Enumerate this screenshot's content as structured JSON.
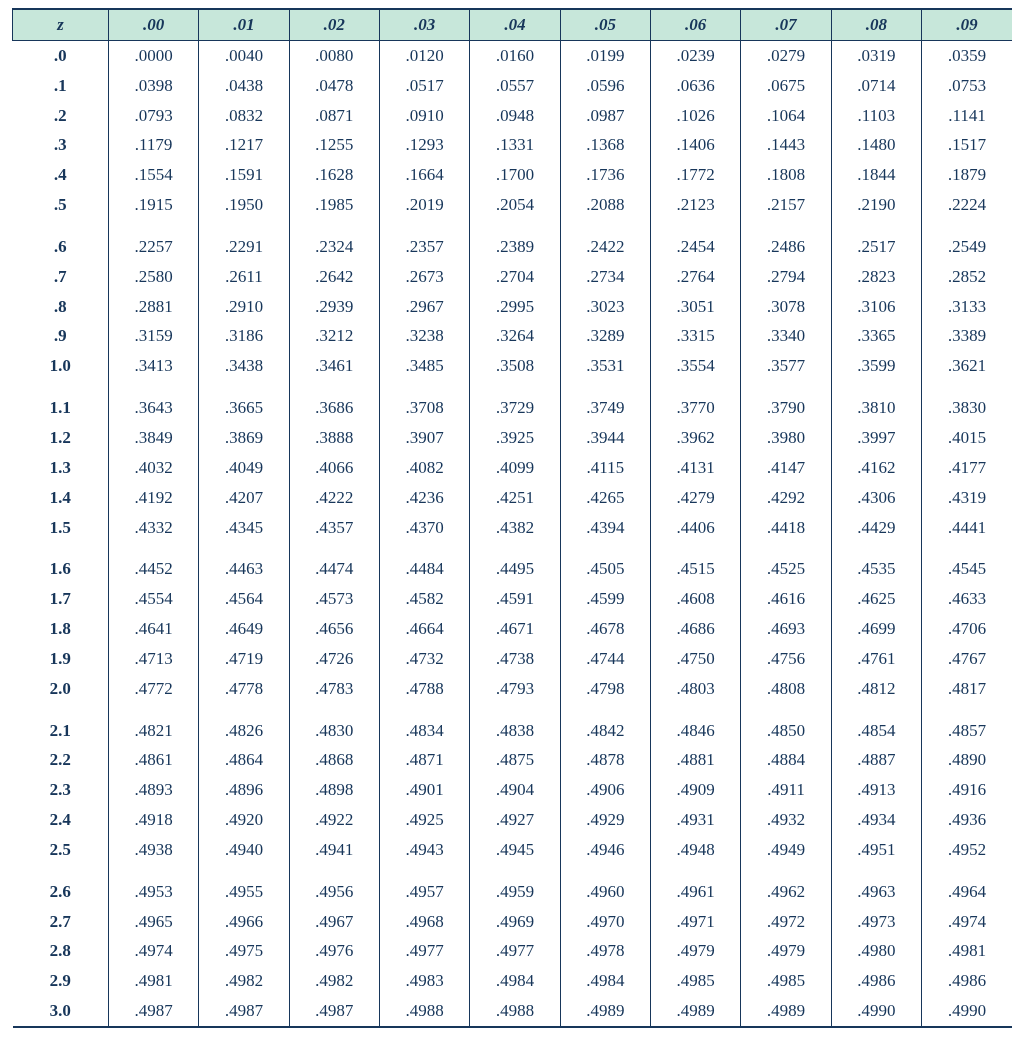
{
  "chart_data": {
    "type": "table",
    "title": "",
    "corner_label": "z",
    "columns": [
      ".00",
      ".01",
      ".02",
      ".03",
      ".04",
      ".05",
      ".06",
      ".07",
      ".08",
      ".09"
    ],
    "group_size": 5,
    "first_group_size": 6,
    "rows": [
      {
        "z": ".0",
        "v": [
          ".0000",
          ".0040",
          ".0080",
          ".0120",
          ".0160",
          ".0199",
          ".0239",
          ".0279",
          ".0319",
          ".0359"
        ]
      },
      {
        "z": ".1",
        "v": [
          ".0398",
          ".0438",
          ".0478",
          ".0517",
          ".0557",
          ".0596",
          ".0636",
          ".0675",
          ".0714",
          ".0753"
        ]
      },
      {
        "z": ".2",
        "v": [
          ".0793",
          ".0832",
          ".0871",
          ".0910",
          ".0948",
          ".0987",
          ".1026",
          ".1064",
          ".1103",
          ".1141"
        ]
      },
      {
        "z": ".3",
        "v": [
          ".1179",
          ".1217",
          ".1255",
          ".1293",
          ".1331",
          ".1368",
          ".1406",
          ".1443",
          ".1480",
          ".1517"
        ]
      },
      {
        "z": ".4",
        "v": [
          ".1554",
          ".1591",
          ".1628",
          ".1664",
          ".1700",
          ".1736",
          ".1772",
          ".1808",
          ".1844",
          ".1879"
        ]
      },
      {
        "z": ".5",
        "v": [
          ".1915",
          ".1950",
          ".1985",
          ".2019",
          ".2054",
          ".2088",
          ".2123",
          ".2157",
          ".2190",
          ".2224"
        ]
      },
      {
        "z": ".6",
        "v": [
          ".2257",
          ".2291",
          ".2324",
          ".2357",
          ".2389",
          ".2422",
          ".2454",
          ".2486",
          ".2517",
          ".2549"
        ]
      },
      {
        "z": ".7",
        "v": [
          ".2580",
          ".2611",
          ".2642",
          ".2673",
          ".2704",
          ".2734",
          ".2764",
          ".2794",
          ".2823",
          ".2852"
        ]
      },
      {
        "z": ".8",
        "v": [
          ".2881",
          ".2910",
          ".2939",
          ".2967",
          ".2995",
          ".3023",
          ".3051",
          ".3078",
          ".3106",
          ".3133"
        ]
      },
      {
        "z": ".9",
        "v": [
          ".3159",
          ".3186",
          ".3212",
          ".3238",
          ".3264",
          ".3289",
          ".3315",
          ".3340",
          ".3365",
          ".3389"
        ]
      },
      {
        "z": "1.0",
        "v": [
          ".3413",
          ".3438",
          ".3461",
          ".3485",
          ".3508",
          ".3531",
          ".3554",
          ".3577",
          ".3599",
          ".3621"
        ]
      },
      {
        "z": "1.1",
        "v": [
          ".3643",
          ".3665",
          ".3686",
          ".3708",
          ".3729",
          ".3749",
          ".3770",
          ".3790",
          ".3810",
          ".3830"
        ]
      },
      {
        "z": "1.2",
        "v": [
          ".3849",
          ".3869",
          ".3888",
          ".3907",
          ".3925",
          ".3944",
          ".3962",
          ".3980",
          ".3997",
          ".4015"
        ]
      },
      {
        "z": "1.3",
        "v": [
          ".4032",
          ".4049",
          ".4066",
          ".4082",
          ".4099",
          ".4115",
          ".4131",
          ".4147",
          ".4162",
          ".4177"
        ]
      },
      {
        "z": "1.4",
        "v": [
          ".4192",
          ".4207",
          ".4222",
          ".4236",
          ".4251",
          ".4265",
          ".4279",
          ".4292",
          ".4306",
          ".4319"
        ]
      },
      {
        "z": "1.5",
        "v": [
          ".4332",
          ".4345",
          ".4357",
          ".4370",
          ".4382",
          ".4394",
          ".4406",
          ".4418",
          ".4429",
          ".4441"
        ]
      },
      {
        "z": "1.6",
        "v": [
          ".4452",
          ".4463",
          ".4474",
          ".4484",
          ".4495",
          ".4505",
          ".4515",
          ".4525",
          ".4535",
          ".4545"
        ]
      },
      {
        "z": "1.7",
        "v": [
          ".4554",
          ".4564",
          ".4573",
          ".4582",
          ".4591",
          ".4599",
          ".4608",
          ".4616",
          ".4625",
          ".4633"
        ]
      },
      {
        "z": "1.8",
        "v": [
          ".4641",
          ".4649",
          ".4656",
          ".4664",
          ".4671",
          ".4678",
          ".4686",
          ".4693",
          ".4699",
          ".4706"
        ]
      },
      {
        "z": "1.9",
        "v": [
          ".4713",
          ".4719",
          ".4726",
          ".4732",
          ".4738",
          ".4744",
          ".4750",
          ".4756",
          ".4761",
          ".4767"
        ]
      },
      {
        "z": "2.0",
        "v": [
          ".4772",
          ".4778",
          ".4783",
          ".4788",
          ".4793",
          ".4798",
          ".4803",
          ".4808",
          ".4812",
          ".4817"
        ]
      },
      {
        "z": "2.1",
        "v": [
          ".4821",
          ".4826",
          ".4830",
          ".4834",
          ".4838",
          ".4842",
          ".4846",
          ".4850",
          ".4854",
          ".4857"
        ]
      },
      {
        "z": "2.2",
        "v": [
          ".4861",
          ".4864",
          ".4868",
          ".4871",
          ".4875",
          ".4878",
          ".4881",
          ".4884",
          ".4887",
          ".4890"
        ]
      },
      {
        "z": "2.3",
        "v": [
          ".4893",
          ".4896",
          ".4898",
          ".4901",
          ".4904",
          ".4906",
          ".4909",
          ".4911",
          ".4913",
          ".4916"
        ]
      },
      {
        "z": "2.4",
        "v": [
          ".4918",
          ".4920",
          ".4922",
          ".4925",
          ".4927",
          ".4929",
          ".4931",
          ".4932",
          ".4934",
          ".4936"
        ]
      },
      {
        "z": "2.5",
        "v": [
          ".4938",
          ".4940",
          ".4941",
          ".4943",
          ".4945",
          ".4946",
          ".4948",
          ".4949",
          ".4951",
          ".4952"
        ]
      },
      {
        "z": "2.6",
        "v": [
          ".4953",
          ".4955",
          ".4956",
          ".4957",
          ".4959",
          ".4960",
          ".4961",
          ".4962",
          ".4963",
          ".4964"
        ]
      },
      {
        "z": "2.7",
        "v": [
          ".4965",
          ".4966",
          ".4967",
          ".4968",
          ".4969",
          ".4970",
          ".4971",
          ".4972",
          ".4973",
          ".4974"
        ]
      },
      {
        "z": "2.8",
        "v": [
          ".4974",
          ".4975",
          ".4976",
          ".4977",
          ".4977",
          ".4978",
          ".4979",
          ".4979",
          ".4980",
          ".4981"
        ]
      },
      {
        "z": "2.9",
        "v": [
          ".4981",
          ".4982",
          ".4982",
          ".4983",
          ".4984",
          ".4984",
          ".4985",
          ".4985",
          ".4986",
          ".4986"
        ]
      },
      {
        "z": "3.0",
        "v": [
          ".4987",
          ".4987",
          ".4987",
          ".4988",
          ".4988",
          ".4989",
          ".4989",
          ".4989",
          ".4990",
          ".4990"
        ]
      }
    ]
  }
}
